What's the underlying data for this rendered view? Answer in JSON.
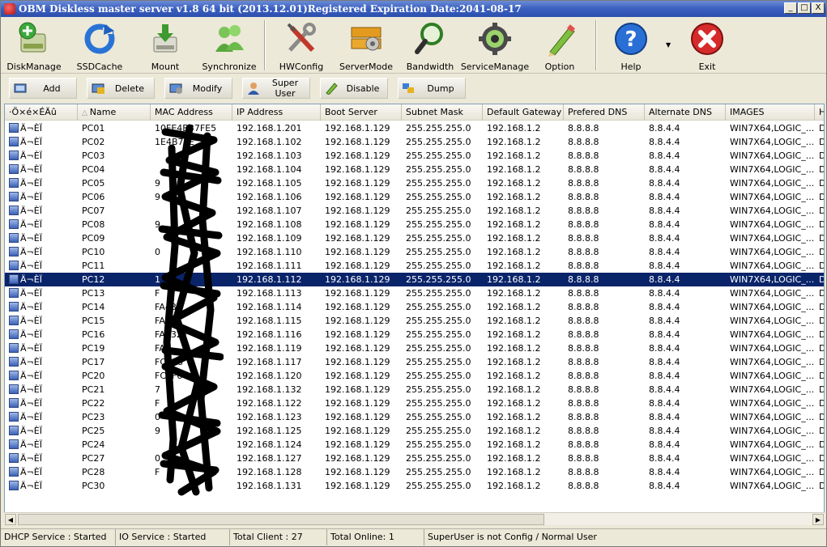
{
  "window": {
    "title": "OBM Diskless master server v1.8 64 bit  (2013.12.01)Registered Expiration Date:2041-08-17",
    "controls": [
      "_",
      "□",
      "X"
    ]
  },
  "toolbar": [
    {
      "key": "diskmanage",
      "label": "DiskManage",
      "icon": "disk-manage-icon"
    },
    {
      "key": "ssdcache",
      "label": "SSDCache",
      "icon": "refresh-icon"
    },
    {
      "key": "mount",
      "label": "Mount",
      "icon": "mount-icon"
    },
    {
      "key": "synchronize",
      "label": "Synchronize",
      "icon": "users-icon"
    },
    {
      "key": "hwconfig",
      "label": "HWConfig",
      "icon": "tools-icon"
    },
    {
      "key": "servermode",
      "label": "ServerMode",
      "icon": "server-gear-icon"
    },
    {
      "key": "bandwidth",
      "label": "Bandwidth",
      "icon": "magnifier-icon"
    },
    {
      "key": "servicemanage",
      "label": "ServiceManage",
      "icon": "service-gear-icon"
    },
    {
      "key": "option",
      "label": "Option",
      "icon": "pencil-icon"
    },
    {
      "key": "help",
      "label": "Help",
      "icon": "help-icon"
    },
    {
      "key": "exit",
      "label": "Exit",
      "icon": "exit-icon"
    }
  ],
  "actions": [
    {
      "key": "add",
      "label": "Add"
    },
    {
      "key": "delete",
      "label": "Delete"
    },
    {
      "key": "modify",
      "label": "Modify"
    },
    {
      "key": "superuser",
      "label": "Super User"
    },
    {
      "key": "disable",
      "label": "Disable"
    },
    {
      "key": "dump",
      "label": "Dump"
    }
  ],
  "grid": {
    "columns": [
      "·Ö×é×ÉÄû",
      "Name",
      "MAC Address",
      "IP Address",
      "Boot Server",
      "Subnet Mask",
      "Default Gateway",
      "Prefered DNS",
      "Alternate DNS",
      "IMAGES",
      "H"
    ],
    "selected_index": 11,
    "rows": [
      {
        "group": "Ä¬ÈÏ",
        "name": "PC01",
        "mac": "10FE4B37FE5",
        "ip": "192.168.1.201",
        "boot": "192.168.1.129",
        "mask": "255.255.255.0",
        "gw": "192.168.1.2",
        "dns1": "8.8.8.8",
        "dns2": "8.8.4.4",
        "images": "WIN7X64,LOGIC_...",
        "h": "D"
      },
      {
        "group": "Ä¬ÈÏ",
        "name": "PC02",
        "mac": "1E4B7FE",
        "ip": "192.168.1.102",
        "boot": "192.168.1.129",
        "mask": "255.255.255.0",
        "gw": "192.168.1.2",
        "dns1": "8.8.8.8",
        "dns2": "8.8.4.4",
        "images": "WIN7X64,LOGIC_...",
        "h": "D"
      },
      {
        "group": "Ä¬ÈÏ",
        "name": "PC03",
        "mac": "",
        "ip": "192.168.1.103",
        "boot": "192.168.1.129",
        "mask": "255.255.255.0",
        "gw": "192.168.1.2",
        "dns1": "8.8.8.8",
        "dns2": "8.8.4.4",
        "images": "WIN7X64,LOGIC_...",
        "h": "D"
      },
      {
        "group": "Ä¬ÈÏ",
        "name": "PC04",
        "mac": "",
        "ip": "192.168.1.104",
        "boot": "192.168.1.129",
        "mask": "255.255.255.0",
        "gw": "192.168.1.2",
        "dns1": "8.8.8.8",
        "dns2": "8.8.4.4",
        "images": "WIN7X64,LOGIC_...",
        "h": "D"
      },
      {
        "group": "Ä¬ÈÏ",
        "name": "PC05",
        "mac": "9",
        "ip": "192.168.1.105",
        "boot": "192.168.1.129",
        "mask": "255.255.255.0",
        "gw": "192.168.1.2",
        "dns1": "8.8.8.8",
        "dns2": "8.8.4.4",
        "images": "WIN7X64,LOGIC_...",
        "h": "D"
      },
      {
        "group": "Ä¬ÈÏ",
        "name": "PC06",
        "mac": "9",
        "ip": "192.168.1.106",
        "boot": "192.168.1.129",
        "mask": "255.255.255.0",
        "gw": "192.168.1.2",
        "dns1": "8.8.8.8",
        "dns2": "8.8.4.4",
        "images": "WIN7X64,LOGIC_...",
        "h": "D"
      },
      {
        "group": "Ä¬ÈÏ",
        "name": "PC07",
        "mac": "",
        "ip": "192.168.1.107",
        "boot": "192.168.1.129",
        "mask": "255.255.255.0",
        "gw": "192.168.1.2",
        "dns1": "8.8.8.8",
        "dns2": "8.8.4.4",
        "images": "WIN7X64,LOGIC_...",
        "h": "D"
      },
      {
        "group": "Ä¬ÈÏ",
        "name": "PC08",
        "mac": "9",
        "ip": "192.168.1.108",
        "boot": "192.168.1.129",
        "mask": "255.255.255.0",
        "gw": "192.168.1.2",
        "dns1": "8.8.8.8",
        "dns2": "8.8.4.4",
        "images": "WIN7X64,LOGIC_...",
        "h": "D"
      },
      {
        "group": "Ä¬ÈÏ",
        "name": "PC09",
        "mac": "",
        "ip": "192.168.1.109",
        "boot": "192.168.1.129",
        "mask": "255.255.255.0",
        "gw": "192.168.1.2",
        "dns1": "8.8.8.8",
        "dns2": "8.8.4.4",
        "images": "WIN7X64,LOGIC_...",
        "h": "D"
      },
      {
        "group": "Ä¬ÈÏ",
        "name": "PC10",
        "mac": "0",
        "ip": "192.168.1.110",
        "boot": "192.168.1.129",
        "mask": "255.255.255.0",
        "gw": "192.168.1.2",
        "dns1": "8.8.8.8",
        "dns2": "8.8.4.4",
        "images": "WIN7X64,LOGIC_...",
        "h": "D"
      },
      {
        "group": "Ä¬ÈÏ",
        "name": "PC11",
        "mac": "",
        "ip": "192.168.1.111",
        "boot": "192.168.1.129",
        "mask": "255.255.255.0",
        "gw": "192.168.1.2",
        "dns1": "8.8.8.8",
        "dns2": "8.8.4.4",
        "images": "WIN7X64,LOGIC_...",
        "h": "D"
      },
      {
        "group": "Ä¬ÈÏ",
        "name": "PC12",
        "mac": "1",
        "ip": "192.168.1.112",
        "boot": "192.168.1.129",
        "mask": "255.255.255.0",
        "gw": "192.168.1.2",
        "dns1": "8.8.8.8",
        "dns2": "8.8.4.4",
        "images": "WIN7X64,LOGIC_...",
        "h": "D"
      },
      {
        "group": "Ä¬ÈÏ",
        "name": "PC13",
        "mac": "F",
        "ip": "192.168.1.113",
        "boot": "192.168.1.129",
        "mask": "255.255.255.0",
        "gw": "192.168.1.2",
        "dns1": "8.8.8.8",
        "dns2": "8.8.4.4",
        "images": "WIN7X64,LOGIC_...",
        "h": "D"
      },
      {
        "group": "Ä¬ÈÏ",
        "name": "PC14",
        "mac": "FA43",
        "ip": "192.168.1.114",
        "boot": "192.168.1.129",
        "mask": "255.255.255.0",
        "gw": "192.168.1.2",
        "dns1": "8.8.8.8",
        "dns2": "8.8.4.4",
        "images": "WIN7X64,LOGIC_...",
        "h": "D"
      },
      {
        "group": "Ä¬ÈÏ",
        "name": "PC15",
        "mac": "FA437",
        "ip": "192.168.1.115",
        "boot": "192.168.1.129",
        "mask": "255.255.255.0",
        "gw": "192.168.1.2",
        "dns1": "8.8.8.8",
        "dns2": "8.8.4.4",
        "images": "WIN7X64,LOGIC_...",
        "h": "D"
      },
      {
        "group": "Ä¬ÈÏ",
        "name": "PC16",
        "mac": "FA432F",
        "ip": "192.168.1.116",
        "boot": "192.168.1.129",
        "mask": "255.255.255.0",
        "gw": "192.168.1.2",
        "dns1": "8.8.8.8",
        "dns2": "8.8.4.4",
        "images": "WIN7X64,LOGIC_...",
        "h": "D"
      },
      {
        "group": "Ä¬ÈÏ",
        "name": "PC19",
        "mac": "FA4",
        "ip": "192.168.1.119",
        "boot": "192.168.1.129",
        "mask": "255.255.255.0",
        "gw": "192.168.1.2",
        "dns1": "8.8.8.8",
        "dns2": "8.8.4.4",
        "images": "WIN7X64,LOGIC_...",
        "h": "D"
      },
      {
        "group": "Ä¬ÈÏ",
        "name": "PC17",
        "mac": "FCEE8",
        "ip": "192.168.1.117",
        "boot": "192.168.1.129",
        "mask": "255.255.255.0",
        "gw": "192.168.1.2",
        "dns1": "8.8.8.8",
        "dns2": "8.8.4.4",
        "images": "WIN7X64,LOGIC_...",
        "h": "D"
      },
      {
        "group": "Ä¬ÈÏ",
        "name": "PC20",
        "mac": "FCEF6",
        "ip": "192.168.1.120",
        "boot": "192.168.1.129",
        "mask": "255.255.255.0",
        "gw": "192.168.1.2",
        "dns1": "8.8.8.8",
        "dns2": "8.8.4.4",
        "images": "WIN7X64,LOGIC_...",
        "h": "D"
      },
      {
        "group": "Ä¬ÈÏ",
        "name": "PC21",
        "mac": "7",
        "ip": "192.168.1.132",
        "boot": "192.168.1.129",
        "mask": "255.255.255.0",
        "gw": "192.168.1.2",
        "dns1": "8.8.8.8",
        "dns2": "8.8.4.4",
        "images": "WIN7X64,LOGIC_...",
        "h": "D"
      },
      {
        "group": "Ä¬ÈÏ",
        "name": "PC22",
        "mac": "F",
        "ip": "192.168.1.122",
        "boot": "192.168.1.129",
        "mask": "255.255.255.0",
        "gw": "192.168.1.2",
        "dns1": "8.8.8.8",
        "dns2": "8.8.4.4",
        "images": "WIN7X64,LOGIC_...",
        "h": "D"
      },
      {
        "group": "Ä¬ÈÏ",
        "name": "PC23",
        "mac": "0",
        "ip": "192.168.1.123",
        "boot": "192.168.1.129",
        "mask": "255.255.255.0",
        "gw": "192.168.1.2",
        "dns1": "8.8.8.8",
        "dns2": "8.8.4.4",
        "images": "WIN7X64,LOGIC_...",
        "h": "D"
      },
      {
        "group": "Ä¬ÈÏ",
        "name": "PC25",
        "mac": "9",
        "ip": "192.168.1.125",
        "boot": "192.168.1.129",
        "mask": "255.255.255.0",
        "gw": "192.168.1.2",
        "dns1": "8.8.8.8",
        "dns2": "8.8.4.4",
        "images": "WIN7X64,LOGIC_...",
        "h": "D"
      },
      {
        "group": "Ä¬ÈÏ",
        "name": "PC24",
        "mac": "",
        "ip": "192.168.1.124",
        "boot": "192.168.1.129",
        "mask": "255.255.255.0",
        "gw": "192.168.1.2",
        "dns1": "8.8.8.8",
        "dns2": "8.8.4.4",
        "images": "WIN7X64,LOGIC_...",
        "h": "D"
      },
      {
        "group": "Ä¬ÈÏ",
        "name": "PC27",
        "mac": "0",
        "ip": "192.168.1.127",
        "boot": "192.168.1.129",
        "mask": "255.255.255.0",
        "gw": "192.168.1.2",
        "dns1": "8.8.8.8",
        "dns2": "8.8.4.4",
        "images": "WIN7X64,LOGIC_...",
        "h": "D"
      },
      {
        "group": "Ä¬ÈÏ",
        "name": "PC28",
        "mac": "F",
        "ip": "192.168.1.128",
        "boot": "192.168.1.129",
        "mask": "255.255.255.0",
        "gw": "192.168.1.2",
        "dns1": "8.8.8.8",
        "dns2": "8.8.4.4",
        "images": "WIN7X64,LOGIC_...",
        "h": "D"
      },
      {
        "group": "Ä¬ÈÏ",
        "name": "PC30",
        "mac": "",
        "ip": "192.168.1.131",
        "boot": "192.168.1.129",
        "mask": "255.255.255.0",
        "gw": "192.168.1.2",
        "dns1": "8.8.8.8",
        "dns2": "8.8.4.4",
        "images": "WIN7X64,LOGIC_...",
        "h": "D"
      }
    ]
  },
  "status": [
    "DHCP Service : Started",
    "IO Service : Started",
    "Total Client : 27",
    "Total Online: 1",
    "SuperUser is not Config / Normal User"
  ]
}
